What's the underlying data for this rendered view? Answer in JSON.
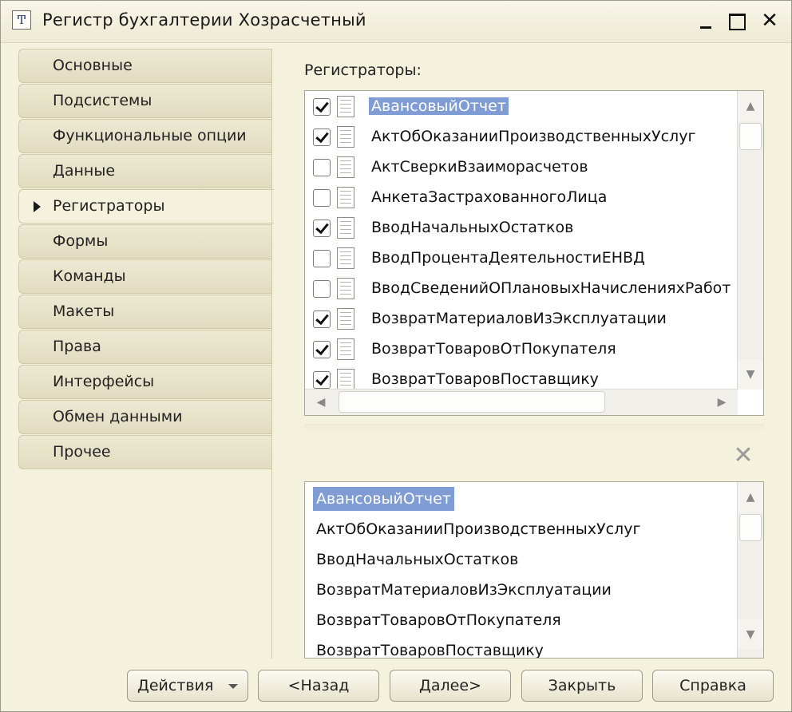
{
  "window": {
    "title": "Регистр бухгалтерии Хозрасчетный",
    "icon_glyph": "Ͳ",
    "close_glyph": "✕"
  },
  "nav": {
    "items": [
      {
        "label": "Основные",
        "active": false
      },
      {
        "label": "Подсистемы",
        "active": false
      },
      {
        "label": "Функциональные опции",
        "active": false
      },
      {
        "label": "Данные",
        "active": false
      },
      {
        "label": "Регистраторы",
        "active": true
      },
      {
        "label": "Формы",
        "active": false
      },
      {
        "label": "Команды",
        "active": false
      },
      {
        "label": "Макеты",
        "active": false
      },
      {
        "label": "Права",
        "active": false
      },
      {
        "label": "Интерфейсы",
        "active": false
      },
      {
        "label": "Обмен данными",
        "active": false
      },
      {
        "label": "Прочее",
        "active": false
      }
    ]
  },
  "registrators": {
    "label": "Регистраторы:",
    "items": [
      {
        "name": "АвансовыйОтчет",
        "checked": true,
        "selected": true
      },
      {
        "name": "АктОбОказанииПроизводственныхУслуг",
        "checked": true,
        "selected": false
      },
      {
        "name": "АктСверкиВзаиморасчетов",
        "checked": false,
        "selected": false
      },
      {
        "name": "АнкетаЗастрахованногоЛица",
        "checked": false,
        "selected": false
      },
      {
        "name": "ВводНачальныхОстатков",
        "checked": true,
        "selected": false
      },
      {
        "name": "ВводПроцентаДеятельностиЕНВД",
        "checked": false,
        "selected": false
      },
      {
        "name": "ВводСведенийОПлановыхНачисленияхРабот",
        "checked": false,
        "selected": false
      },
      {
        "name": "ВозвратМатериаловИзЭксплуатации",
        "checked": true,
        "selected": false
      },
      {
        "name": "ВозвратТоваровОтПокупателя",
        "checked": true,
        "selected": false
      },
      {
        "name": "ВозвратТоваровПоставщику",
        "checked": true,
        "selected": false
      }
    ]
  },
  "selected_list": {
    "clear_glyph": "✕",
    "items": [
      {
        "name": "АвансовыйОтчет",
        "selected": true
      },
      {
        "name": "АктОбОказанииПроизводственныхУслуг",
        "selected": false
      },
      {
        "name": "ВводНачальныхОстатков",
        "selected": false
      },
      {
        "name": "ВозвратМатериаловИзЭксплуатации",
        "selected": false
      },
      {
        "name": "ВозвратТоваровОтПокупателя",
        "selected": false
      },
      {
        "name": "ВозвратТоваровПоставщику",
        "selected": false
      }
    ]
  },
  "scroll": {
    "up": "▲",
    "down": "▼",
    "left": "◀",
    "right": "▶"
  },
  "buttons": {
    "actions": "Действия",
    "back": "<Назад",
    "next": "Далее>",
    "close": "Закрыть",
    "help": "Справка"
  },
  "colors": {
    "selection": "#7f9cd4",
    "window_bg": "#f4f1dc",
    "tab_bg": "#e6e1c6"
  }
}
